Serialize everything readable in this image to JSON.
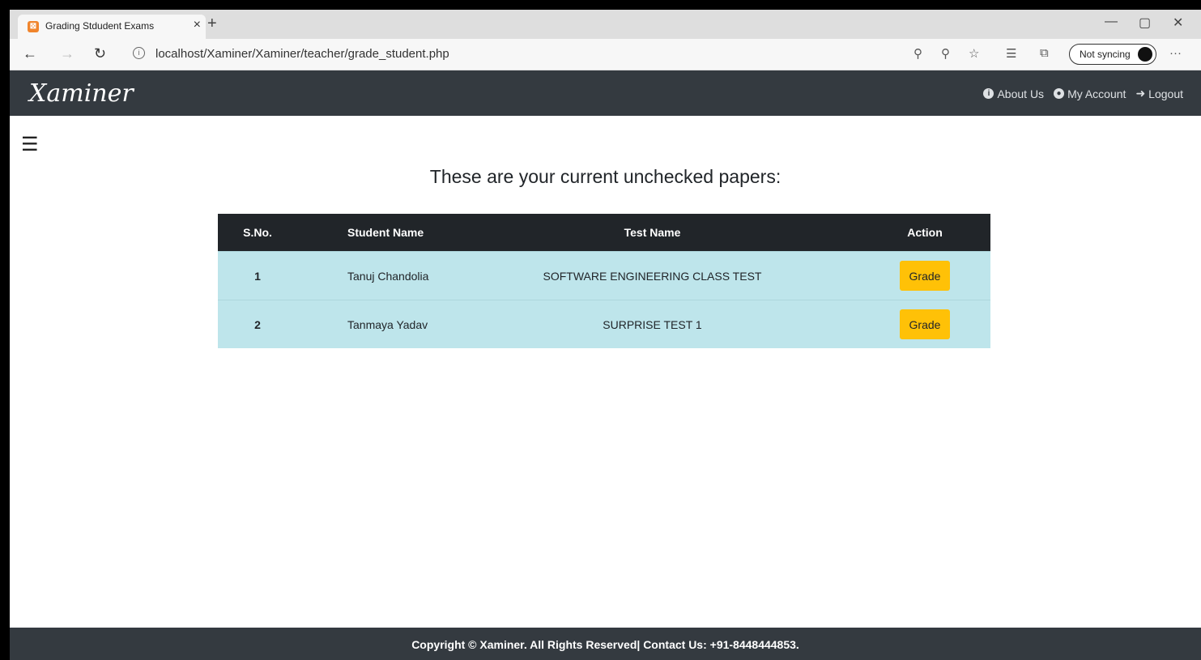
{
  "browser": {
    "tab_title": "Grading Stdudent Exams",
    "url": "localhost/Xaminer/Xaminer/teacher/grade_student.php",
    "sync_label": "Not syncing"
  },
  "navbar": {
    "brand": "Xaminer",
    "links": [
      "About Us",
      "My Account",
      "Logout"
    ]
  },
  "main": {
    "heading": "These are your current unchecked papers:",
    "columns": [
      "S.No.",
      "Student Name",
      "Test Name",
      "Action"
    ],
    "rows": [
      {
        "sno": "1",
        "student": "Tanuj Chandolia",
        "test": "SOFTWARE ENGINEERING CLASS TEST",
        "action": "Grade"
      },
      {
        "sno": "2",
        "student": "Tanmaya Yadav",
        "test": "SURPRISE TEST 1",
        "action": "Grade"
      }
    ]
  },
  "footer": {
    "text": "Copyright © Xaminer. All Rights Reserved| Contact Us: +91-8448444853."
  }
}
